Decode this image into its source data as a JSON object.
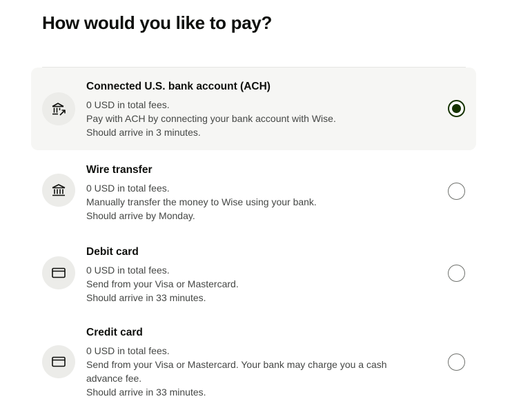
{
  "page": {
    "title": "How would you like to pay?"
  },
  "options": [
    {
      "title": "Connected U.S. bank account (ACH)",
      "fees": "0 USD in total fees.",
      "description": "Pay with ACH by connecting your bank account with Wise.",
      "arrival": "Should arrive in 3 minutes.",
      "icon": "bank-connected-icon",
      "selected": true
    },
    {
      "title": "Wire transfer",
      "fees": "0 USD in total fees.",
      "description": "Manually transfer the money to Wise using your bank.",
      "arrival": "Should arrive by Monday.",
      "icon": "bank-icon",
      "selected": false
    },
    {
      "title": "Debit card",
      "fees": "0 USD in total fees.",
      "description": "Send from your Visa or Mastercard.",
      "arrival": "Should arrive in 33 minutes.",
      "icon": "card-icon",
      "selected": false
    },
    {
      "title": "Credit card",
      "fees": "0 USD in total fees.",
      "description_line1": "Send from your Visa or Mastercard. Your bank may charge you a cash",
      "description_line2": "advance fee.",
      "arrival": "Should arrive in 33 minutes.",
      "icon": "card-icon",
      "selected": false
    }
  ],
  "colors": {
    "selected_background": "#f6f6f4",
    "icon_background": "#ecece9",
    "radio_checked": "#163300",
    "text_primary": "#0e0f0c",
    "text_secondary": "#454745"
  }
}
